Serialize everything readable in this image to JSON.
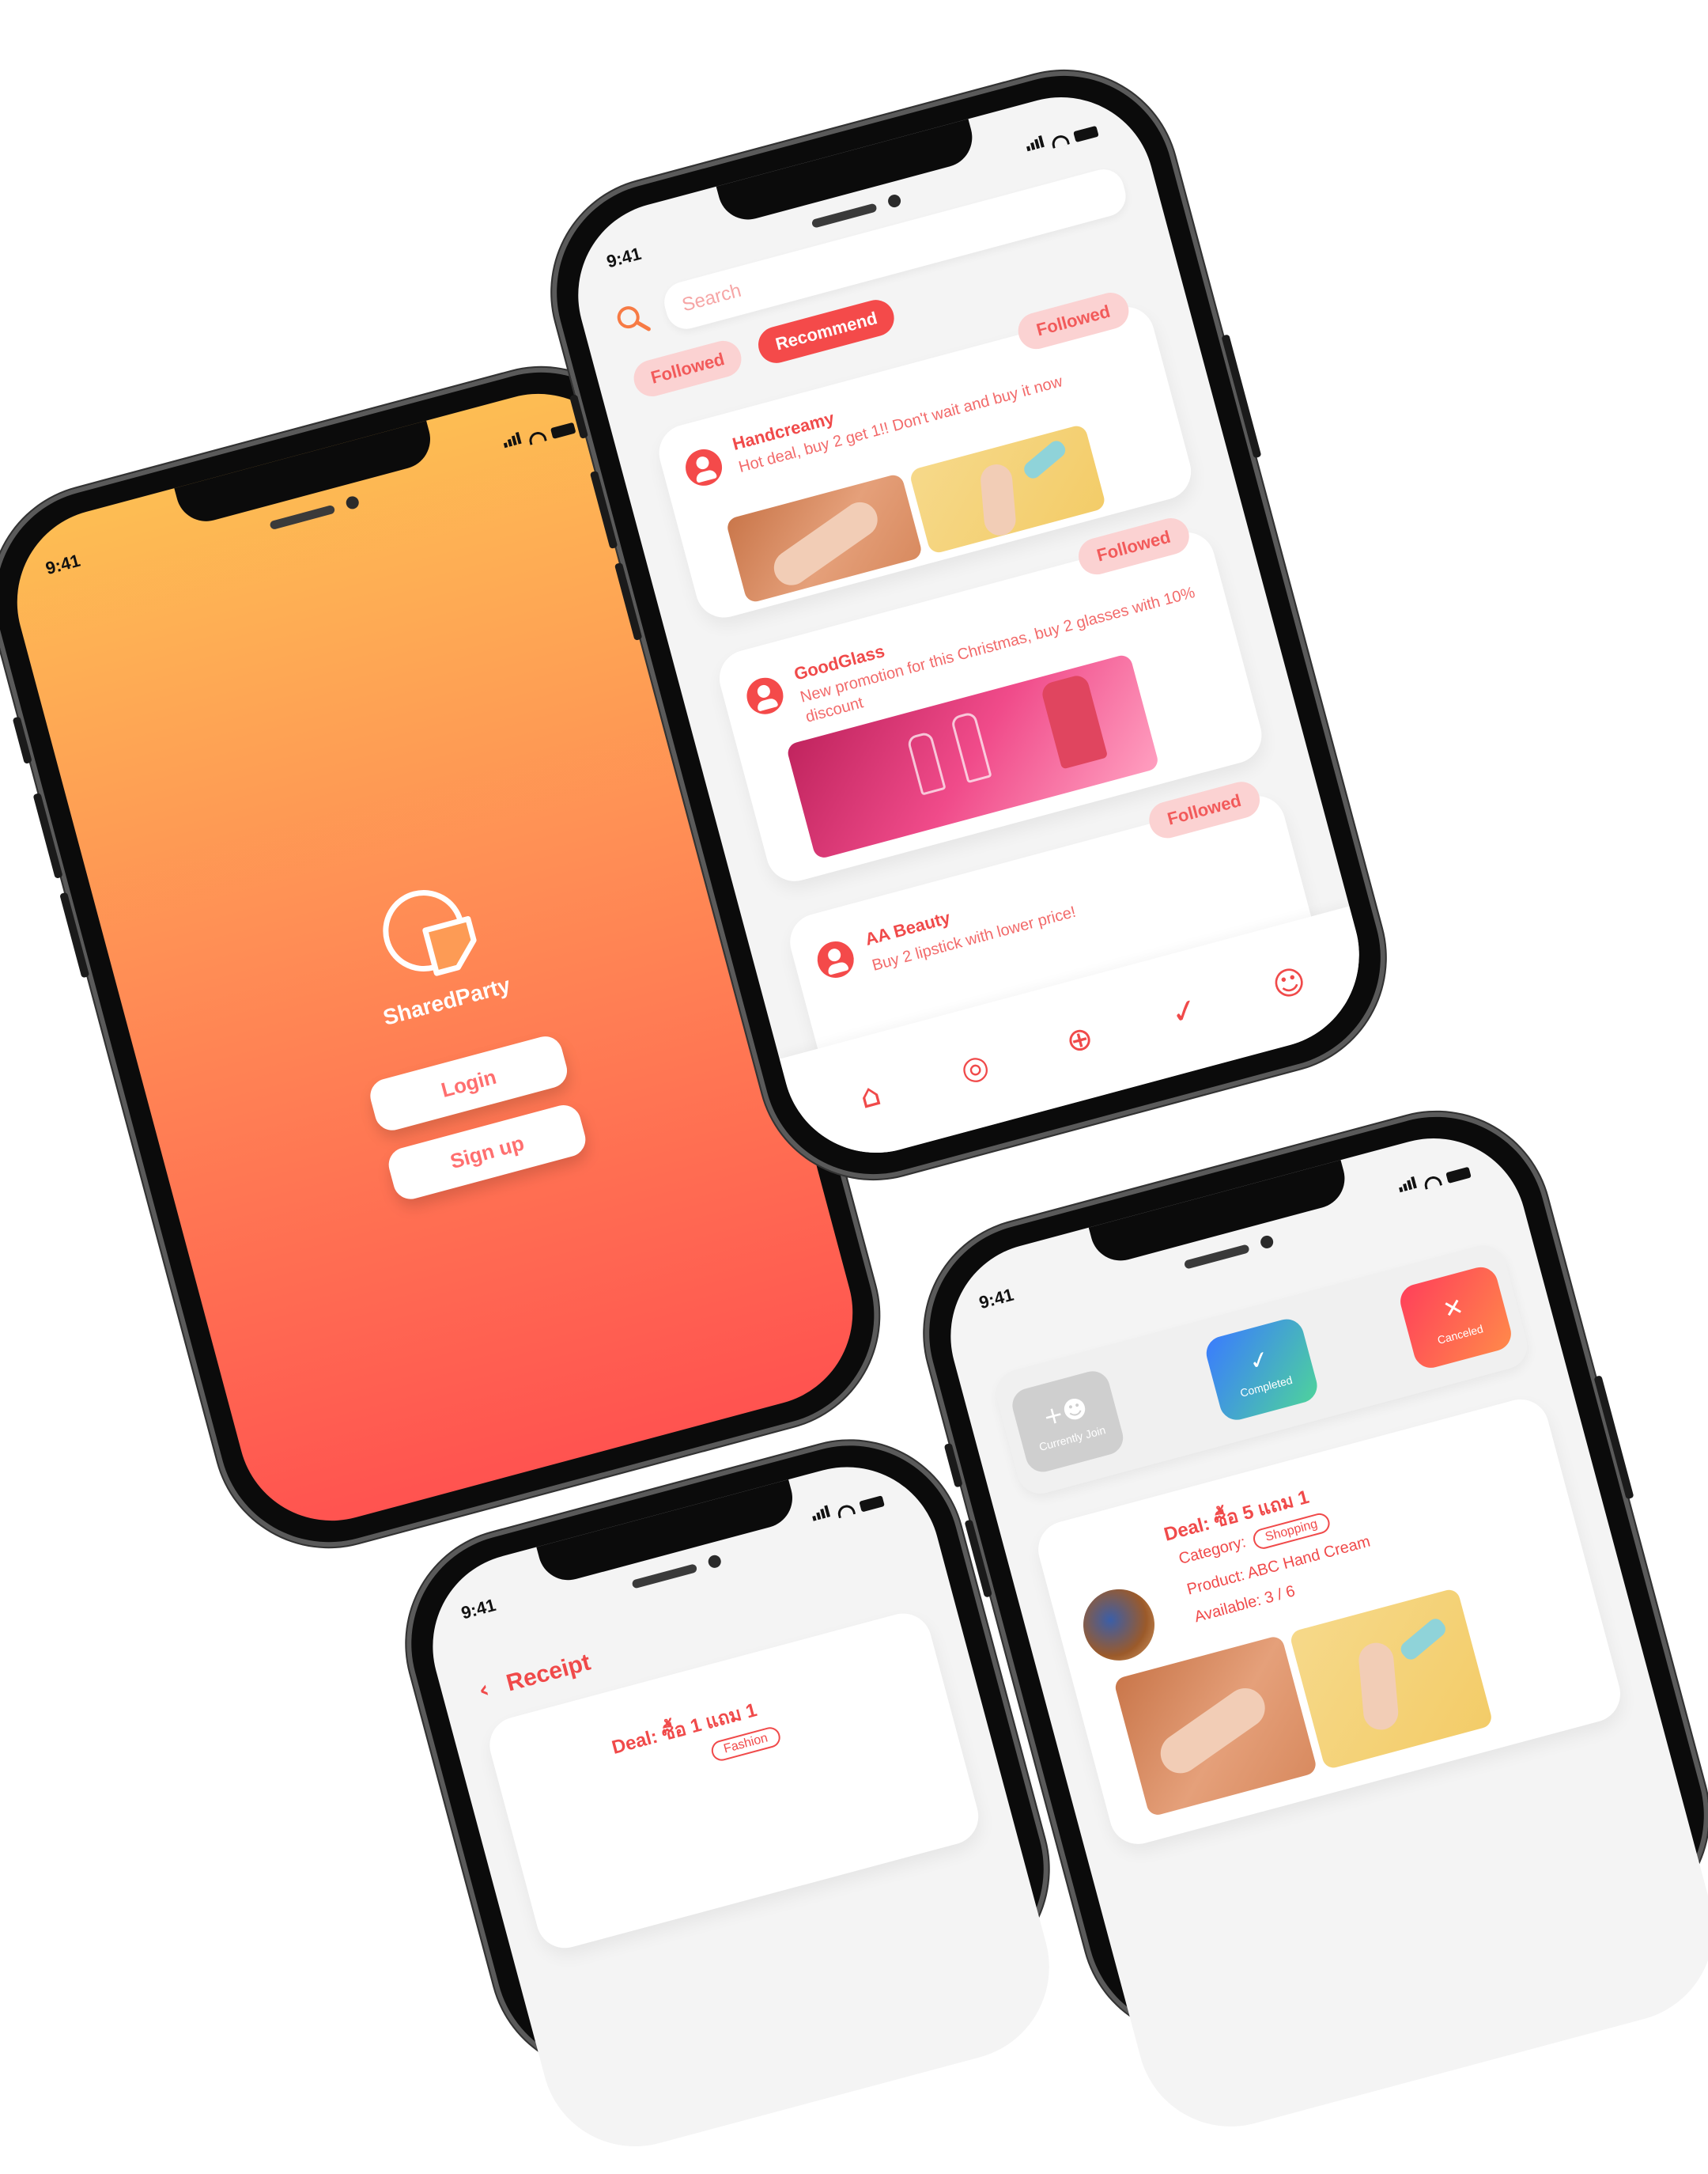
{
  "status_bar": {
    "time": "9:41"
  },
  "login_screen": {
    "brand": "SharedParty",
    "login_label": "Login",
    "signup_label": "Sign up"
  },
  "feed_screen": {
    "search": {
      "placeholder": "Search"
    },
    "filters": [
      "Followed",
      "Recommend"
    ],
    "posts": [
      {
        "shop": "Handcreamy",
        "follow": "Followed",
        "text": "Hot deal, buy 2 get 1!! Don't wait and buy it now"
      },
      {
        "shop": "GoodGlass",
        "follow": "Followed",
        "text": "New promotion for this Christmas, buy 2 glasses with 10% discount"
      },
      {
        "shop": "AA Beauty",
        "follow": "Followed",
        "text": "Buy 2 lipstick with lower price!"
      }
    ],
    "nav": [
      "home-icon",
      "group-icon",
      "add-icon",
      "history-icon",
      "profile-icon"
    ]
  },
  "status_screen": {
    "tabs": [
      {
        "label": "Currently Join",
        "color": "#cfcfcf"
      },
      {
        "label": "Completed",
        "color": "#3a7bff"
      },
      {
        "label": "Canceled",
        "color": "#ff5a4a"
      }
    ],
    "deal": {
      "title": "Deal: ซื้อ 5 แถม 1",
      "category_label": "Category:",
      "category": "Shopping",
      "product": "Product: ABC Hand Cream",
      "available": "Available: 3 / 6"
    }
  },
  "receipt_screen": {
    "title": "Receipt",
    "deal_title": "Deal: ซื้อ 1 แถม 1",
    "category": "Fashion"
  },
  "colors": {
    "accent": "#f04a4a",
    "gradient_top": "#fdbd53",
    "gradient_bottom": "#ff5350"
  }
}
